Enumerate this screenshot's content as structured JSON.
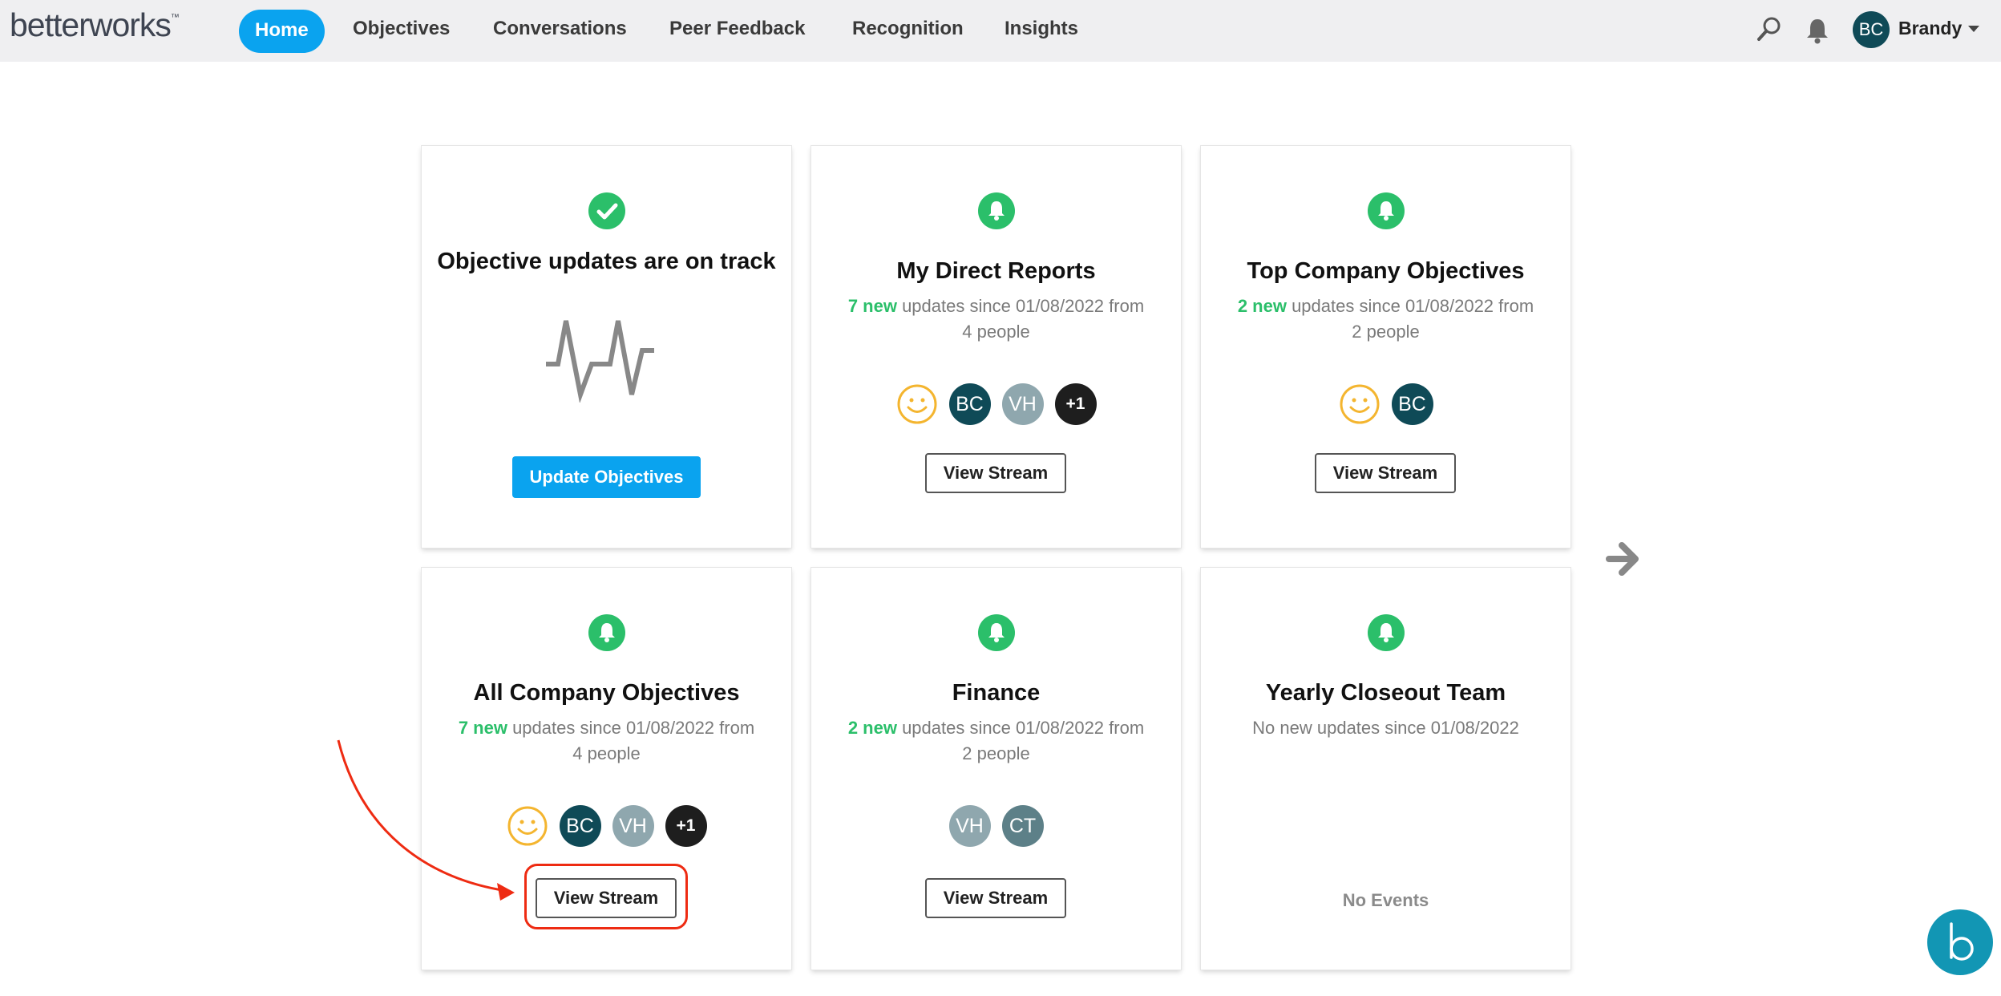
{
  "app": {
    "logo_text": "betterworks",
    "logo_tm": "™"
  },
  "nav": {
    "items": [
      {
        "label": "Home",
        "active": true
      },
      {
        "label": "Objectives",
        "active": false
      },
      {
        "label": "Conversations",
        "active": false
      },
      {
        "label": "Peer Feedback",
        "active": false
      },
      {
        "label": "Recognition",
        "active": false
      },
      {
        "label": "Insights",
        "active": false
      }
    ],
    "search_icon": "search-icon",
    "notification_icon": "bell-icon"
  },
  "user": {
    "initials": "BC",
    "name": "Brandy"
  },
  "cards": [
    {
      "icon": "check-icon",
      "title": "Objective updates are on track",
      "button": "Update Objectives"
    },
    {
      "icon": "bell-icon",
      "title": "My Direct Reports",
      "new_count": "7 new",
      "subtitle": " updates since 01/08/2022 from 4 people",
      "avatars": [
        "smile",
        "BC",
        "VH",
        "+1"
      ],
      "button": "View Stream"
    },
    {
      "icon": "bell-icon",
      "title": "Top Company Objectives",
      "new_count": "2 new",
      "subtitle": " updates since 01/08/2022 from 2 people",
      "avatars": [
        "smile",
        "BC"
      ],
      "button": "View Stream"
    },
    {
      "icon": "bell-icon",
      "title": "All Company Objectives",
      "new_count": "7 new",
      "subtitle": " updates since 01/08/2022 from 4 people",
      "avatars": [
        "smile",
        "BC",
        "VH",
        "+1"
      ],
      "button": "View Stream"
    },
    {
      "icon": "bell-icon",
      "title": "Finance",
      "new_count": "2 new",
      "subtitle": " updates since 01/08/2022 from 2 people",
      "avatars": [
        "VH",
        "CT"
      ],
      "button": "View Stream"
    },
    {
      "icon": "bell-icon",
      "title": "Yearly Closeout Team",
      "subtitle": "No new updates since 01/08/2022",
      "empty_label": "No Events"
    }
  ],
  "colors": {
    "accent": "#0aa3ef",
    "success": "#2bbf6a",
    "annotation": "#ee2b12",
    "avatar_dark": "#0f4a57"
  }
}
